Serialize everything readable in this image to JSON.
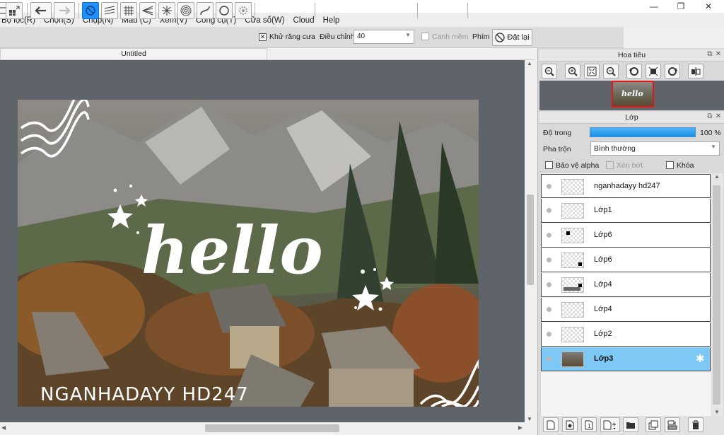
{
  "menu": [
    "Bộ lọc(R)",
    "Chọn(S)",
    "Chụp(N)",
    "Màu (C)",
    "Xem(V)",
    "Công cụ(T)",
    "Cửa sổ(W)",
    "Cloud",
    "Help"
  ],
  "window_controls": {
    "minimize": "—",
    "restore": "❐",
    "close": "✕"
  },
  "toolbar": {
    "antialias_label": "Khử răng cưa",
    "antialias_checked": "✕",
    "adjust_label": "Điều chỉnh",
    "adjust_value": "40",
    "smooth_label": "Cạnh mềm",
    "keys_label": "Phím",
    "reset_label": "Đặt lại"
  },
  "document": {
    "tab_title": "Untitled"
  },
  "artwork": {
    "hello_text": "hello",
    "signature": "NGANHADAYY HD247"
  },
  "navigator": {
    "title": "Hoa tiêu"
  },
  "layers_panel": {
    "title": "Lớp",
    "opacity_label": "Độ trong",
    "opacity_value": "100 %",
    "opacity_level": 1.0,
    "blend_label": "Pha trộn",
    "blend_value": "Bình thường",
    "protect_alpha_label": "Bảo vệ alpha",
    "clipping_label": "Xén bớt",
    "lock_label": "Khóa",
    "layers": [
      {
        "name": "nganhadayy hd247",
        "selected": false
      },
      {
        "name": "Lớp1",
        "selected": false
      },
      {
        "name": "Lớp6",
        "selected": false
      },
      {
        "name": "Lớp6",
        "selected": false
      },
      {
        "name": "Lớp4",
        "selected": false
      },
      {
        "name": "Lớp4",
        "selected": false
      },
      {
        "name": "Lớp2",
        "selected": false
      },
      {
        "name": "Lớp3",
        "selected": true
      }
    ]
  },
  "colors": {
    "accent": "#1e90ff",
    "selected_layer": "#7ec8f5",
    "canvas_bg": "#5f646b"
  }
}
